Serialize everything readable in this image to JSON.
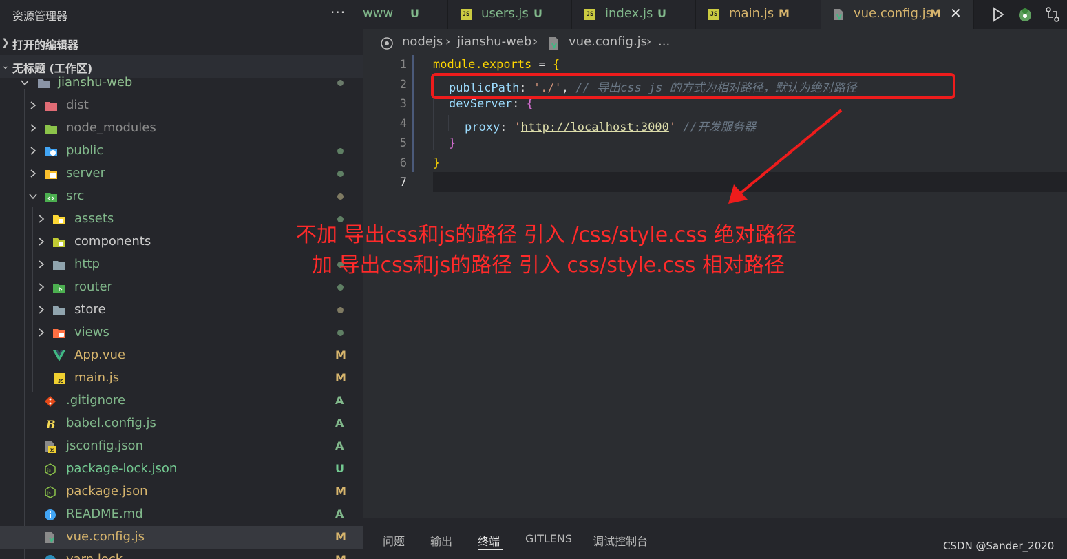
{
  "sidebar": {
    "title": "资源管理器",
    "more": "···",
    "sections": {
      "open_editors": "打开的编辑器",
      "workspace": "无标题 (工作区)"
    },
    "tree": [
      {
        "name": "jianshu-web",
        "status": "dot"
      },
      {
        "name": "dist",
        "status": ""
      },
      {
        "name": "node_modules",
        "status": ""
      },
      {
        "name": "public",
        "status": "dot"
      },
      {
        "name": "server",
        "status": "dot"
      },
      {
        "name": "src",
        "status": "dot"
      },
      {
        "name": "assets",
        "status": "dot"
      },
      {
        "name": "components",
        "status": "dot"
      },
      {
        "name": "http",
        "status": "dot"
      },
      {
        "name": "router",
        "status": "dot"
      },
      {
        "name": "store",
        "status": "dot"
      },
      {
        "name": "views",
        "status": "dot"
      },
      {
        "name": "App.vue",
        "status": "M"
      },
      {
        "name": "main.js",
        "status": "M"
      },
      {
        "name": ".gitignore",
        "status": "A"
      },
      {
        "name": "babel.config.js",
        "status": "A"
      },
      {
        "name": "jsconfig.json",
        "status": "A"
      },
      {
        "name": "package-lock.json",
        "status": "U"
      },
      {
        "name": "package.json",
        "status": "M"
      },
      {
        "name": "README.md",
        "status": "A"
      },
      {
        "name": "vue.config.js",
        "status": "M"
      },
      {
        "name": "yarn.lock",
        "status": "M"
      }
    ]
  },
  "tabs": [
    {
      "name": "www",
      "status": "U"
    },
    {
      "name": "users.js",
      "status": "U"
    },
    {
      "name": "index.js",
      "status": "U"
    },
    {
      "name": "main.js",
      "status": "M"
    },
    {
      "name": "vue.config.js",
      "status": "M",
      "close": "✕"
    }
  ],
  "js_badge": "JS",
  "breadcrumb": [
    "nodejs",
    "jianshu-web",
    "vue.config.js",
    "..."
  ],
  "editor": {
    "line_numbers": [
      "1",
      "2",
      "3",
      "4",
      "5",
      "6",
      "7"
    ],
    "lines": [
      {
        "t1": "module.exports",
        "t2": " = ",
        "t3": "{"
      },
      {
        "t1": "publicPath",
        "t2": ": ",
        "t3": "'./'",
        "t4": ", ",
        "t5": "// 导出css js 的方式为相对路径，默认为绝对路径"
      },
      {
        "t1": "devServer",
        "t2": ": ",
        "t3": "{"
      },
      {
        "t1": "proxy",
        "t2": ": ",
        "t3": "'",
        "t4": "http://localhost:3000",
        "t5": "'",
        "t6": " //开发服务器"
      },
      {
        "t1": "}"
      },
      {
        "t1": "}"
      },
      {}
    ]
  },
  "annotations": {
    "line1": "不加 导出css和js的路径 引入 /css/style.css  绝对路径",
    "line2": "加 导出css和js的路径 引入 css/style.css  相对路径",
    "color": "#ff2a2a"
  },
  "panel": {
    "tabs": [
      "问题",
      "输出",
      "终端",
      "GITLENS",
      "调试控制台"
    ],
    "active": "终端"
  },
  "watermark": "CSDN @Sander_2020",
  "colors": {
    "modified": "#d7b56d",
    "added": "#81b88b",
    "untracked": "#73c991",
    "accent_red": "#ee1c1c"
  }
}
